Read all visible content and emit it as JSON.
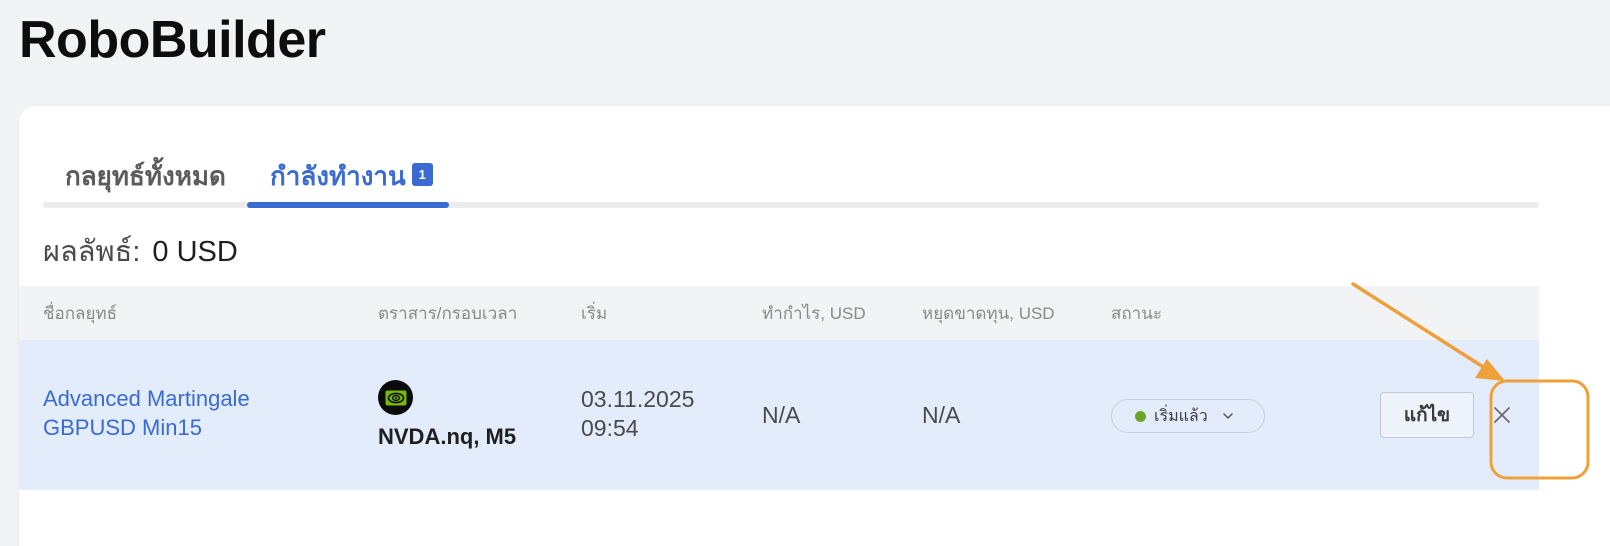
{
  "app": {
    "title": "RoboBuilder"
  },
  "tabs": [
    {
      "label": "กลยุทธ์ทั้งหมด"
    },
    {
      "label": "กำลังทำงาน",
      "badge": "1"
    }
  ],
  "summary": {
    "label": "ผลลัพธ์:",
    "value": "0 USD"
  },
  "table": {
    "headers": [
      "ชื่อกลยุทธ์",
      "ตราสาร/กรอบเวลา",
      "เริ่ม",
      "ทำกำไร, USD",
      "หยุดขาดทุน, USD",
      "สถานะ"
    ],
    "rows": [
      {
        "name_line1": "Advanced Martingale",
        "name_line2": "GBPUSD Min15",
        "symbol_icon": "nvidia-logo-icon",
        "symbol": "NVDA.nq, M5",
        "start_date": "03.11.2025",
        "start_time": "09:54",
        "take_profit": "N/A",
        "stop_loss": "N/A",
        "status": "เริ่มแล้ว",
        "edit_label": "แก้ไข"
      }
    ]
  },
  "colors": {
    "accent": "#3a6bd3",
    "row_highlight": "#e2ecfb",
    "status_active": "#6aa728",
    "annotation": "#f0a03a"
  }
}
